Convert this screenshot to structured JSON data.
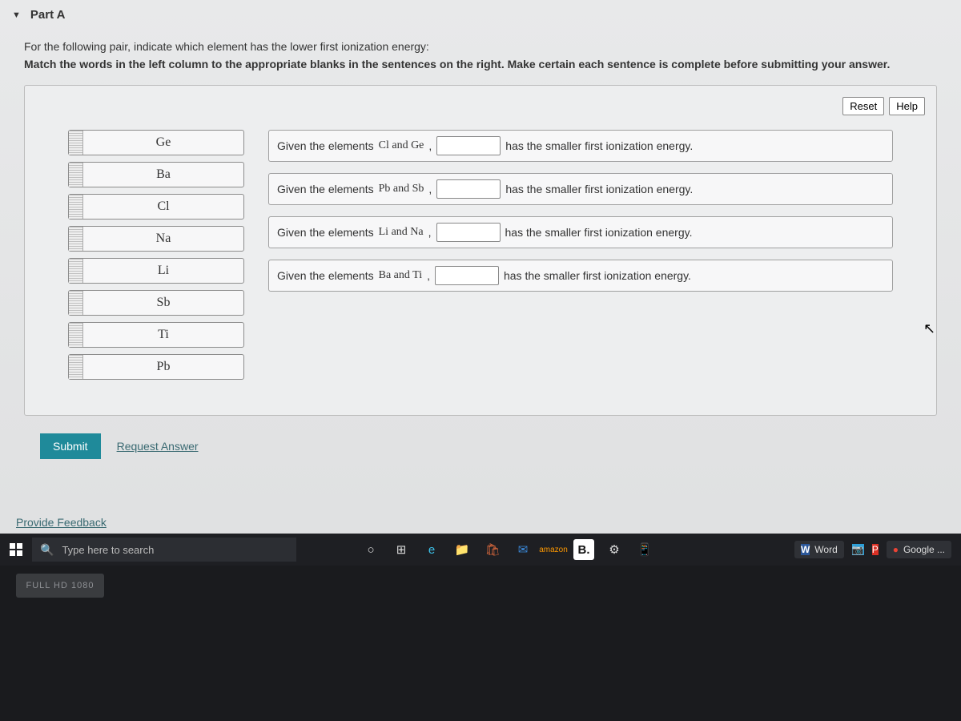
{
  "part": {
    "title": "Part A",
    "instruction1": "For the following pair, indicate which element has the lower first ionization energy:",
    "instruction2": "Match the words in the left column to the appropriate blanks in the sentences on the right. Make certain each sentence is complete before submitting your answer."
  },
  "controls": {
    "reset": "Reset",
    "help": "Help",
    "submit": "Submit",
    "request_answer": "Request Answer",
    "feedback": "Provide Feedback"
  },
  "word_bank": [
    {
      "label": "Ge"
    },
    {
      "label": "Ba"
    },
    {
      "label": "Cl"
    },
    {
      "label": "Na"
    },
    {
      "label": "Li"
    },
    {
      "label": "Sb"
    },
    {
      "label": "Ti"
    },
    {
      "label": "Pb"
    }
  ],
  "sentences": [
    {
      "prefix": "Given the elements",
      "pair": "Cl and Ge",
      "suffix": "has the smaller first ionization energy."
    },
    {
      "prefix": "Given the elements",
      "pair": "Pb and Sb",
      "suffix": "has the smaller first ionization energy."
    },
    {
      "prefix": "Given the elements",
      "pair": "Li and Na",
      "suffix": "has the smaller first ionization energy."
    },
    {
      "prefix": "Given the elements",
      "pair": "Ba and Ti",
      "suffix": "has the smaller first ionization energy."
    }
  ],
  "taskbar": {
    "search_placeholder": "Type here to search",
    "word_label": "Word",
    "google_label": "Google ...",
    "sticker": "FULL HD 1080"
  }
}
